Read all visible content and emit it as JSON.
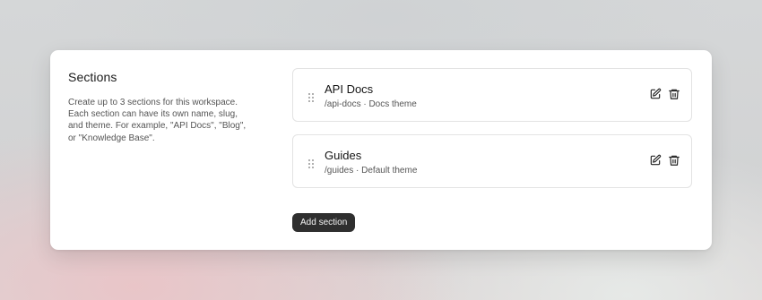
{
  "settings": {
    "title": "Sections",
    "description": "Create up to 3 sections for this workspace. Each section can have its own name, slug, and theme. For example, \"API Docs\", \"Blog\", or \"Knowledge Base\"."
  },
  "sections": [
    {
      "name": "API Docs",
      "meta": "/api-docs · Docs theme"
    },
    {
      "name": "Guides",
      "meta": "/guides · Default theme"
    }
  ],
  "actions": {
    "add_section_label": "Add section"
  },
  "icons": {
    "drag": "drag-handle-icon",
    "edit": "edit-icon",
    "delete": "trash-icon"
  },
  "colors": {
    "button_bg": "#2f2f2f",
    "button_text": "#f5f5f5",
    "card_bg": "#ffffff",
    "border": "#e3e3e3"
  }
}
